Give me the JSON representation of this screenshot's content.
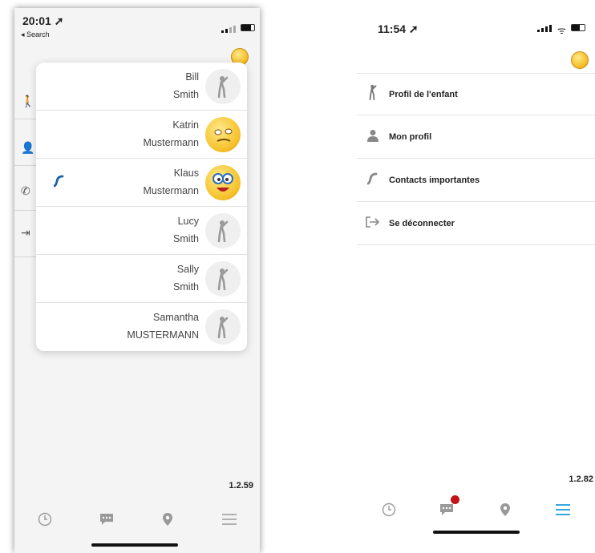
{
  "left": {
    "status": {
      "time": "20:01",
      "back_label": "◂ Search"
    },
    "popup_rows": [
      {
        "first": "Bill",
        "last": "Smith",
        "avatar": "stick-figure-icon",
        "call": false
      },
      {
        "first": "Katrin",
        "last": "Mustermann",
        "avatar": "emoji-icon",
        "call": false
      },
      {
        "first": "Klaus",
        "last": "Mustermann",
        "avatar": "emoji-icon",
        "call": true
      },
      {
        "first": "Lucy",
        "last": "Smith",
        "avatar": "stick-figure-icon",
        "call": false
      },
      {
        "first": "Sally",
        "last": "Smith",
        "avatar": "stick-figure-icon",
        "call": false
      },
      {
        "first": "Samantha",
        "last": "MUSTERMANN",
        "avatar": "stick-figure-icon",
        "call": false
      }
    ],
    "version": "1.2.59",
    "tabs": [
      "clock-icon",
      "chat-icon",
      "location-icon",
      "menu-icon"
    ]
  },
  "right": {
    "status": {
      "time": "11:54"
    },
    "menu": [
      {
        "label": "Profil de l'enfant",
        "icon": "child-icon"
      },
      {
        "label": "Mon profil",
        "icon": "user-icon"
      },
      {
        "label": "Contacts importantes",
        "icon": "phone-icon"
      },
      {
        "label": "Se déconnecter",
        "icon": "logout-icon"
      }
    ],
    "version": "1.2.82",
    "tabs": [
      "clock-icon",
      "chat-icon",
      "location-icon",
      "menu-icon"
    ],
    "colors": {
      "accent": "#1a9bd7",
      "badge": "#c0141b"
    }
  }
}
